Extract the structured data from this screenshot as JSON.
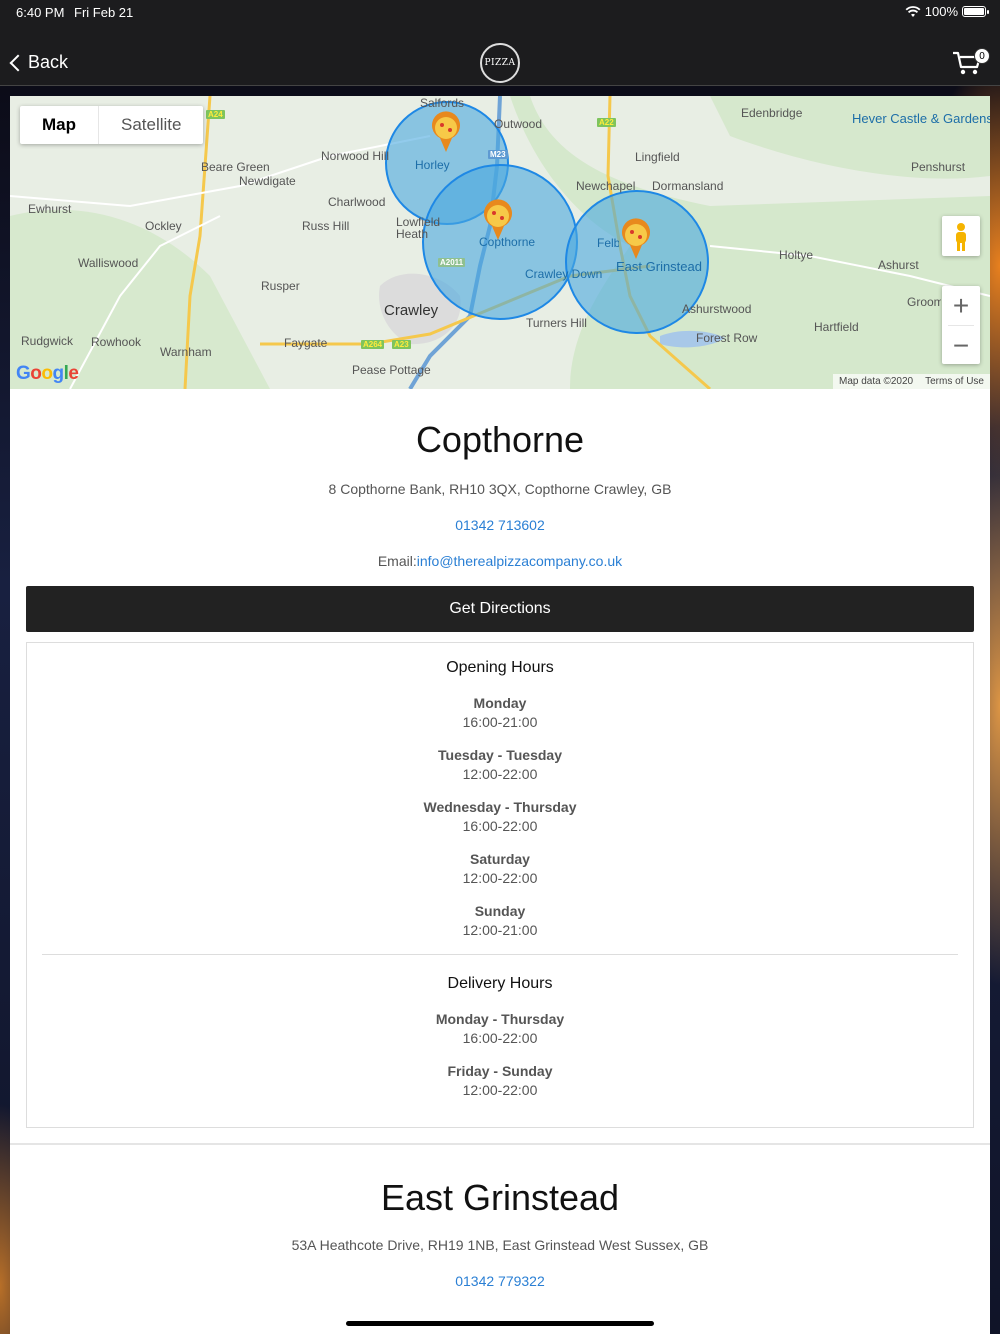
{
  "status_bar": {
    "time": "6:40 PM",
    "date": "Fri Feb 21",
    "battery": "100%"
  },
  "nav": {
    "back_label": "Back",
    "logo_text": "PIZZA",
    "cart_count": "0"
  },
  "map": {
    "type_map": "Map",
    "type_satellite": "Satellite",
    "google": "Google",
    "attribution": "Map data ©2020",
    "terms": "Terms of Use",
    "zoom_in": "+",
    "zoom_out": "−",
    "places": [
      "Salfords",
      "Outwood",
      "Edenbridge",
      "Hever Castle & Gardens",
      "Norwood Hill",
      "Horley",
      "Lingfield",
      "Beare Green",
      "Newdigate",
      "Penshurst",
      "Newchapel",
      "Dormansland",
      "Ewhurst",
      "Charlwood",
      "Ockley",
      "Russ Hill",
      "Lowfield Heath",
      "Copthorne",
      "Felbridge",
      "East Grinstead",
      "Holtye",
      "Ashurst",
      "Walliswood",
      "Crawley Down",
      "Rusper",
      "Crawley",
      "Groombridge",
      "Ashurstwood",
      "Turners Hill",
      "Hartfield",
      "Forest Row",
      "Rudgwick",
      "Rowhook",
      "Faygate",
      "Warnham",
      "Pease Pottage"
    ],
    "roads": [
      "A24",
      "A22",
      "M23",
      "A2011",
      "A264",
      "A23"
    ]
  },
  "store1": {
    "name": "Copthorne",
    "address": "8 Copthorne Bank, RH10 3QX, Copthorne Crawley, GB",
    "phone": "01342 713602",
    "email_label": "Email:",
    "email": "info@therealpizzacompany.co.uk",
    "directions_label": "Get Directions",
    "opening_title": "Opening Hours",
    "opening": [
      {
        "day": "Monday",
        "time": "16:00-21:00"
      },
      {
        "day": "Tuesday - Tuesday",
        "time": "12:00-22:00"
      },
      {
        "day": "Wednesday - Thursday",
        "time": "16:00-22:00"
      },
      {
        "day": "Saturday",
        "time": "12:00-22:00"
      },
      {
        "day": "Sunday",
        "time": "12:00-21:00"
      }
    ],
    "delivery_title": "Delivery Hours",
    "delivery": [
      {
        "day": "Monday - Thursday",
        "time": "16:00-22:00"
      },
      {
        "day": "Friday - Sunday",
        "time": "12:00-22:00"
      }
    ]
  },
  "store2": {
    "name": "East Grinstead",
    "address": "53A Heathcote Drive, RH19 1NB, East Grinstead West Sussex, GB",
    "phone": "01342 779322"
  }
}
